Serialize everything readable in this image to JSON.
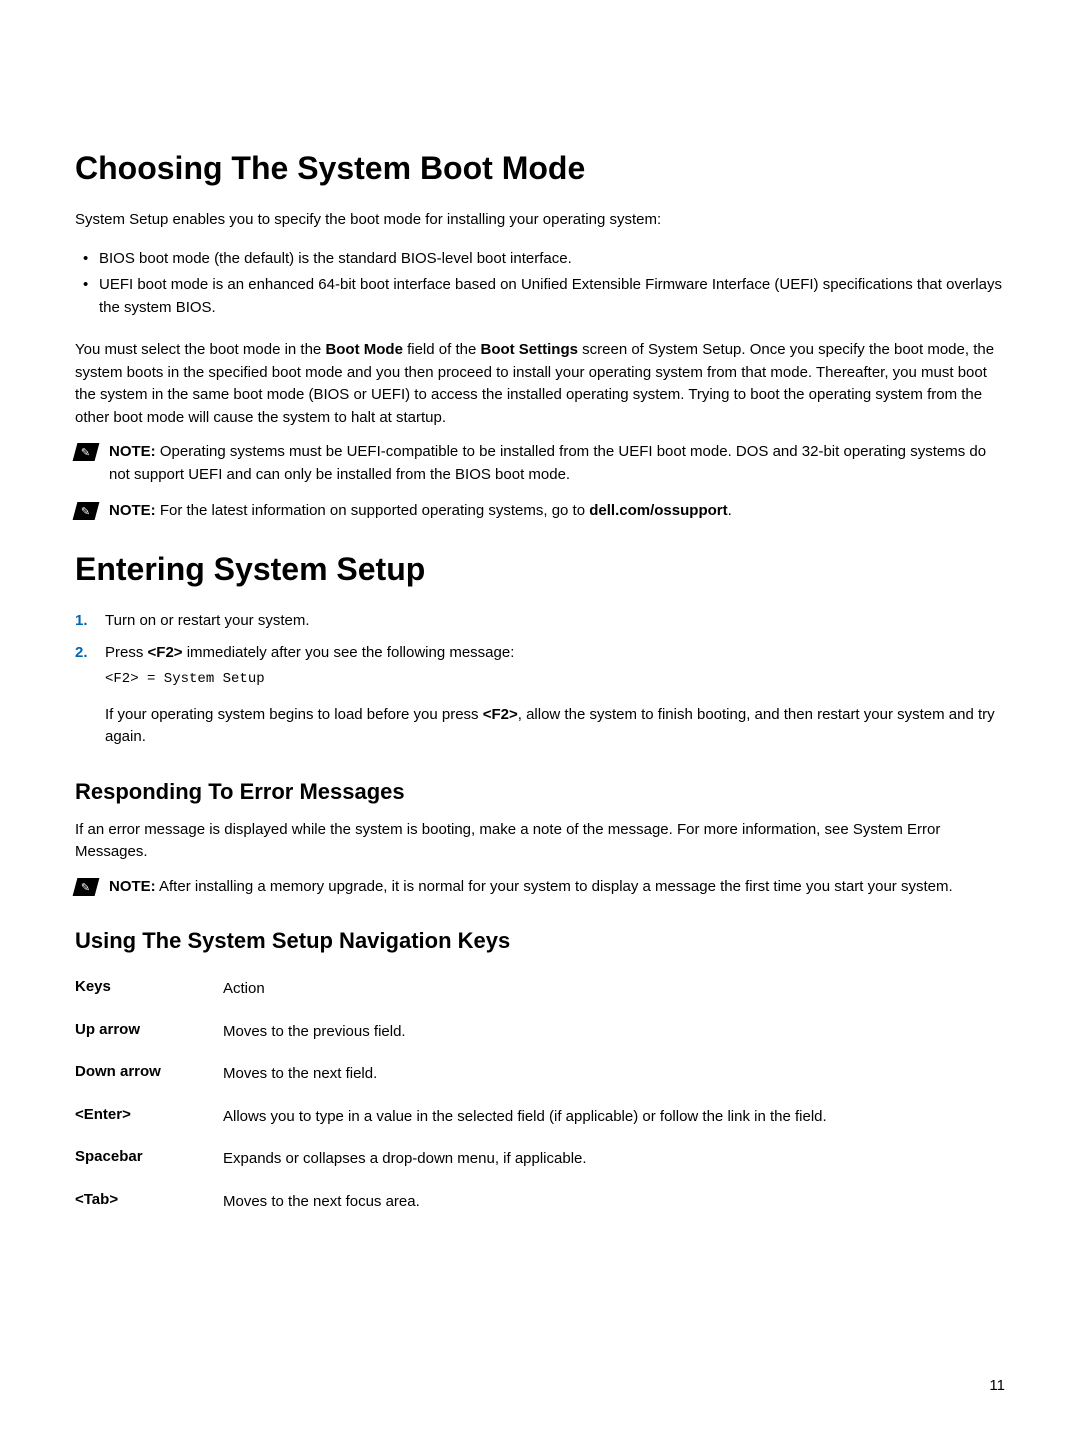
{
  "heading1": "Choosing The System Boot Mode",
  "intro": "System Setup enables you to specify the boot mode for installing your operating system:",
  "bullets": [
    "BIOS boot mode (the default) is the standard BIOS-level boot interface.",
    "UEFI boot mode is an enhanced 64-bit boot interface based on Unified Extensible Firmware Interface (UEFI) specifications that overlays the system BIOS."
  ],
  "para1_pre": "You must select the boot mode in the ",
  "para1_b1": "Boot Mode",
  "para1_mid1": " field of the ",
  "para1_b2": "Boot Settings",
  "para1_post": " screen of System Setup. Once you specify the boot mode, the system boots in the specified boot mode and you then proceed to install your operating system from that mode. Thereafter, you must boot the system in the same boot mode (BIOS or UEFI) to access the installed operating system. Trying to boot the operating system from the other boot mode will cause the system to halt at startup.",
  "note1_label": "NOTE:",
  "note1_text": " Operating systems must be UEFI-compatible to be installed from the UEFI boot mode. DOS and 32-bit operating systems do not support UEFI and can only be installed from the BIOS boot mode.",
  "note2_label": "NOTE:",
  "note2_pre": " For the latest information on supported operating systems, go to ",
  "note2_link": "dell.com/ossupport",
  "note2_post": ".",
  "heading2": "Entering System Setup",
  "step1_num": "1.",
  "step1_text": "Turn on or restart your system.",
  "step2_num": "2.",
  "step2_pre": "Press ",
  "step2_key": "<F2>",
  "step2_post": " immediately after you see the following message:",
  "step2_code": "<F2> = System Setup",
  "step2_sub_pre": "If your operating system begins to load before you press ",
  "step2_sub_key": "<F2>",
  "step2_sub_post": ", allow the system to finish booting, and then restart your system and try again.",
  "heading3": "Responding To Error Messages",
  "error_para": "If an error message is displayed while the system is booting, make a note of the message. For more information, see System Error Messages.",
  "note3_label": "NOTE:",
  "note3_text": " After installing a memory upgrade, it is normal for your system to display a message the first time you start your system.",
  "heading4": "Using The System Setup Navigation Keys",
  "table": {
    "header": {
      "col1": "Keys",
      "col2": "Action"
    },
    "rows": [
      {
        "key": "Up arrow",
        "action": "Moves to the previous field."
      },
      {
        "key": "Down arrow",
        "action": "Moves to the next field."
      },
      {
        "key": "<Enter>",
        "action": "Allows you to type in a value in the selected field (if applicable) or follow the link in the field."
      },
      {
        "key": "Spacebar",
        "action": "Expands or collapses a drop-down menu, if applicable."
      },
      {
        "key": "<Tab>",
        "action": "Moves to the next focus area."
      }
    ]
  },
  "page_number": "11",
  "icon_glyph": "✎"
}
